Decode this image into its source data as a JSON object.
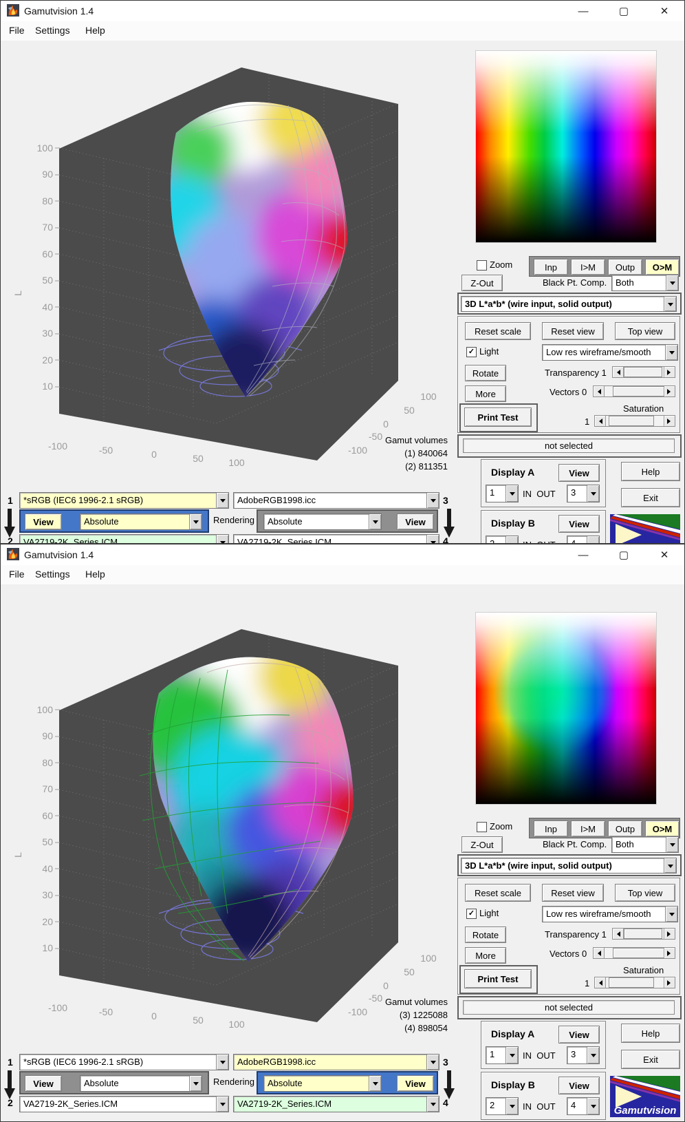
{
  "shared": {
    "window_title": "Gamutvision 1.4",
    "menu": [
      "File",
      "Settings",
      "Help"
    ],
    "plot": {
      "axis_label": "L",
      "yticks": [
        "100",
        "90",
        "80",
        "70",
        "60",
        "50",
        "40",
        "30",
        "20",
        "10"
      ],
      "xticks": [
        "-100",
        "-50",
        "0",
        "50",
        "100"
      ],
      "zticks": [
        "100",
        "50",
        "0",
        "-50",
        "-100"
      ]
    },
    "panel": {
      "zoom": "Zoom",
      "inp": "Inp",
      "i_m": "I>M",
      "outp": "Outp",
      "o_m": "O>M",
      "z_out": "Z-Out",
      "bpc_label": "Black Pt. Comp.",
      "bpc_value": "Both",
      "mode": "3D L*a*b* (wire input, solid output)",
      "reset_scale": "Reset scale",
      "reset_view": "Reset view",
      "top_view": "Top view",
      "light": "Light",
      "light_check": "✓",
      "wireframe": "Low res wireframe/smooth",
      "rotate": "Rotate",
      "transparency": "Transparency 1",
      "more": "More",
      "vectors": "Vectors 0",
      "print_test": "Print Test",
      "saturation": "Saturation",
      "saturation_value": "1",
      "status": "not selected",
      "display_a": "Display A",
      "display_b": "Display B",
      "view": "View",
      "in_out": "IN  OUT",
      "a_in": "1",
      "a_out": "3",
      "b_in": "2",
      "b_out": "4",
      "help": "Help",
      "exit": "Exit",
      "logo": "Gamutvision"
    },
    "bottom": {
      "n1": "1",
      "n2": "2",
      "n3": "3",
      "n4": "4",
      "profile1": "*sRGB   (IEC6 1996-2.1 sRGB)",
      "profile2": "VA2719-2K_Series.ICM",
      "profile3": "AdobeRGB1998.icc",
      "profile4": "VA2719-2K_Series.ICM",
      "view_left": "View",
      "view_right": "View",
      "rendering": "Rendering",
      "intent_left": "Absolute",
      "intent_right": "Absolute"
    }
  },
  "win1": {
    "volumes": {
      "title": "Gamut volumes",
      "line1": "(1)  840064",
      "line2": "(2)  811351"
    }
  },
  "win2": {
    "volumes": {
      "title": "Gamut volumes",
      "line1": "(3)  1225088",
      "line2": "(4)  898054"
    }
  }
}
